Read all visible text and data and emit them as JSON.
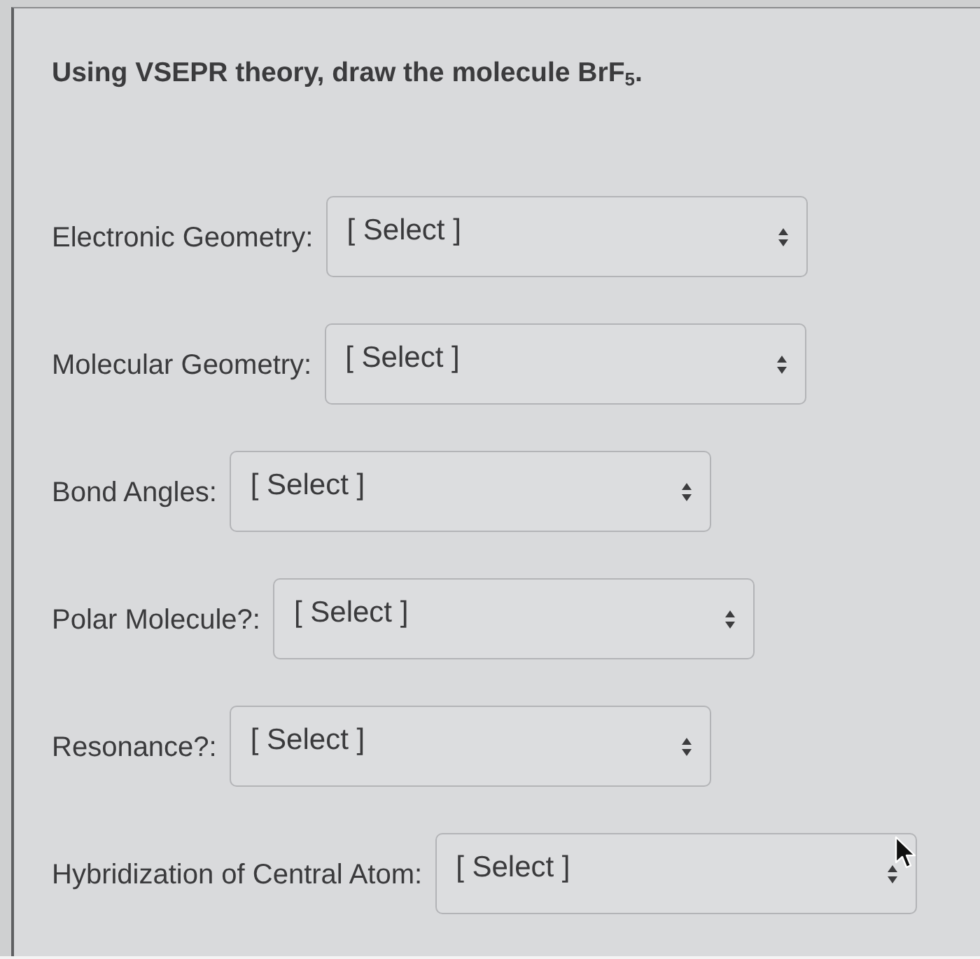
{
  "question": "Using VSEPR theory, draw the molecule BrF$_{5}$.",
  "fields": [
    {
      "label": "Electronic Geometry:",
      "value": "[ Select ]"
    },
    {
      "label": "Molecular Geometry:",
      "value": "[ Select ]"
    },
    {
      "label": "Bond Angles:",
      "value": "[ Select ]"
    },
    {
      "label": "Polar Molecule?:",
      "value": "[ Select ]"
    },
    {
      "label": "Resonance?:",
      "value": "[ Select ]"
    },
    {
      "label": "Hybridization of Central Atom:",
      "value": "[ Select ]"
    }
  ]
}
